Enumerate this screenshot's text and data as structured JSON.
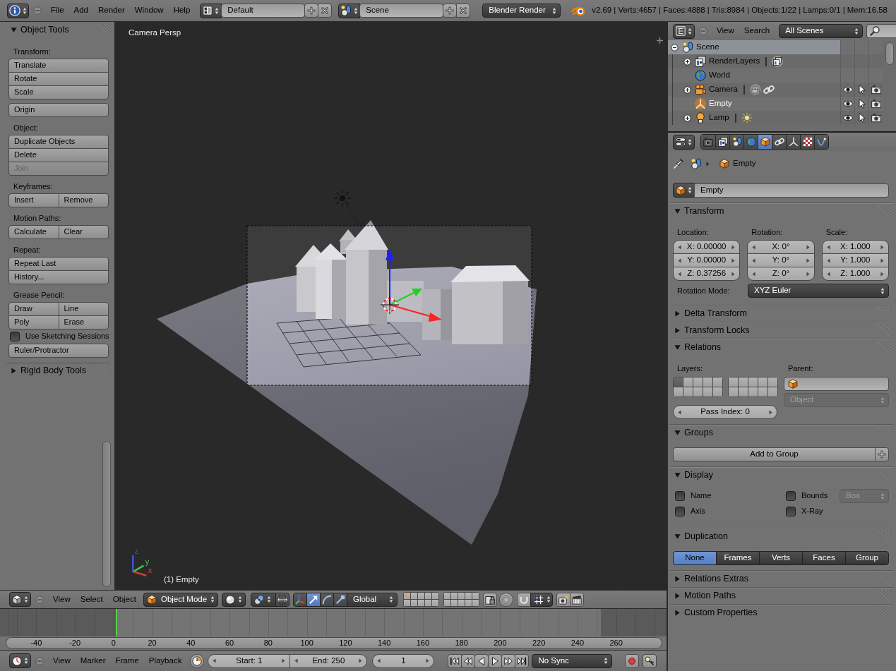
{
  "top_bar": {
    "menus": [
      "File",
      "Add",
      "Render",
      "Window",
      "Help"
    ],
    "layout": "Default",
    "scene": "Scene",
    "render_engine": "Blender Render",
    "stats": "v2.69 | Verts:4657 | Faces:4888 | Tris:8984 | Objects:1/22 | Lamps:0/1 | Mem:16.58"
  },
  "tool_shelf": {
    "panels": [
      {
        "title": "Object Tools",
        "expanded": true,
        "sections": [
          {
            "label": "Transform:",
            "rows": [
              [
                {
                  "kind": "button",
                  "label": "Translate",
                  "disabled": false
                }
              ],
              [
                {
                  "kind": "button",
                  "label": "Rotate",
                  "disabled": false
                }
              ],
              [
                {
                  "kind": "button",
                  "label": "Scale",
                  "disabled": false
                }
              ]
            ]
          },
          {
            "rows": [
              [
                {
                  "kind": "button",
                  "label": "Origin",
                  "disabled": false
                }
              ]
            ]
          },
          {
            "label": "Object:",
            "rows": [
              [
                {
                  "kind": "button",
                  "label": "Duplicate Objects",
                  "disabled": false
                }
              ],
              [
                {
                  "kind": "button",
                  "label": "Delete",
                  "disabled": false
                }
              ],
              [
                {
                  "kind": "button",
                  "label": "Join",
                  "disabled": true
                }
              ]
            ]
          },
          {
            "label": "Keyframes:",
            "rows": [
              [
                {
                  "kind": "button",
                  "label": "Insert",
                  "disabled": false
                },
                {
                  "kind": "button",
                  "label": "Remove",
                  "disabled": false
                }
              ]
            ]
          },
          {
            "label": "Motion Paths:",
            "rows": [
              [
                {
                  "kind": "button",
                  "label": "Calculate",
                  "disabled": false
                },
                {
                  "kind": "button",
                  "label": "Clear",
                  "disabled": false
                }
              ]
            ]
          },
          {
            "label": "Repeat:",
            "rows": [
              [
                {
                  "kind": "button",
                  "label": "Repeat Last",
                  "disabled": false
                }
              ],
              [
                {
                  "kind": "button",
                  "label": "History...",
                  "disabled": false
                }
              ]
            ]
          },
          {
            "label": "Grease Pencil:",
            "rows": [
              [
                {
                  "kind": "button",
                  "label": "Draw",
                  "disabled": false
                },
                {
                  "kind": "button",
                  "label": "Line",
                  "disabled": false
                }
              ],
              [
                {
                  "kind": "button",
                  "label": "Poly",
                  "disabled": false
                },
                {
                  "kind": "button",
                  "label": "Erase",
                  "disabled": false
                }
              ],
              [
                {
                  "kind": "checkbox",
                  "label": "Use Sketching Sessions",
                  "checked": false
                }
              ],
              [
                {
                  "kind": "button",
                  "label": "Ruler/Protractor",
                  "disabled": false
                }
              ]
            ]
          }
        ]
      },
      {
        "title": "Rigid Body Tools",
        "expanded": false
      }
    ]
  },
  "viewport": {
    "view_name": "Camera Persp",
    "axes": [
      {
        "label": "z",
        "color": "#3c50dc"
      },
      {
        "label": "y",
        "color": "#46c846"
      },
      {
        "label": "x",
        "color": "#d23c3c"
      }
    ],
    "object_info": "(1) Empty"
  },
  "view_header": {
    "menus": [
      "View",
      "Select",
      "Object"
    ],
    "mode": "Object Mode",
    "manipulators": [
      {
        "kind": "toggle",
        "selected": false
      },
      {
        "kind": "translate",
        "selected": true
      },
      {
        "kind": "rotate",
        "selected": false
      },
      {
        "kind": "scale",
        "selected": false
      }
    ],
    "orientation": "Global",
    "layers": [
      {
        "cells": [
          {
            "used": true
          },
          {
            "used": false
          },
          {
            "used": false
          },
          {
            "used": false
          },
          {
            "used": false
          },
          {
            "used": false
          },
          {
            "used": false
          },
          {
            "used": false
          },
          {
            "used": false
          },
          {
            "used": false
          }
        ]
      },
      {
        "cells": [
          {
            "used": false
          },
          {
            "used": false
          },
          {
            "used": false
          },
          {
            "used": false
          },
          {
            "used": false
          },
          {
            "used": false
          },
          {
            "used": false
          },
          {
            "used": false
          },
          {
            "used": false
          },
          {
            "used": false
          }
        ]
      }
    ]
  },
  "timeline": {
    "frame_numbers": [
      "-40",
      "-20",
      "0",
      "20",
      "40",
      "60",
      "80",
      "100",
      "120",
      "140",
      "160",
      "180",
      "200",
      "220",
      "240",
      "260"
    ],
    "playhead": {
      "level": 0.174
    }
  },
  "timeline_header": {
    "menus": [
      "View",
      "Marker",
      "Frame",
      "Playback"
    ],
    "start": "Start: 1",
    "end": "End: 250",
    "current_frame": "1",
    "sync": "No Sync"
  },
  "outliner": {
    "menus": [
      "View",
      "Search"
    ],
    "filter": "All Scenes",
    "tree": [
      {
        "label": "Scene",
        "kind": "scene",
        "expanded": true,
        "selected": true,
        "active": false,
        "children": [
          {
            "label": "RenderLayers",
            "kind": "render_layers",
            "expanded": false,
            "selected": false,
            "active": false
          },
          {
            "label": "World",
            "kind": "world",
            "selected": false,
            "active": false
          },
          {
            "label": "Camera",
            "kind": "camera",
            "expanded": false,
            "selected": false,
            "active": false
          },
          {
            "label": "Empty",
            "kind": "empty",
            "selected": false,
            "active": true
          },
          {
            "label": "Lamp",
            "kind": "lamp",
            "expanded": false,
            "selected": false,
            "active": false
          }
        ]
      }
    ]
  },
  "properties": {
    "tabs": [
      {
        "kind": "render",
        "selected": false
      },
      {
        "kind": "render_layers",
        "selected": false
      },
      {
        "kind": "scene",
        "selected": false
      },
      {
        "kind": "world",
        "selected": false
      },
      {
        "kind": "object",
        "selected": true
      },
      {
        "kind": "constraints",
        "selected": false
      },
      {
        "kind": "data",
        "selected": false
      },
      {
        "kind": "texture",
        "selected": false
      },
      {
        "kind": "physics",
        "selected": false
      }
    ],
    "breadcrumb": "Empty",
    "object_name": "Empty",
    "panels": [
      {
        "kind": "transform",
        "title": "Transform",
        "expanded": true,
        "columns": [
          {
            "label": "Location:",
            "fields": [
              "X: 0.00000",
              "Y: 0.00000",
              "Z: 0.37256"
            ]
          },
          {
            "label": "Rotation:",
            "fields": [
              "X: 0°",
              "Y: 0°",
              "Z: 0°"
            ]
          },
          {
            "label": "Scale:",
            "fields": [
              "X: 1.000",
              "Y: 1.000",
              "Z: 1.000"
            ]
          }
        ],
        "rotation_mode": {
          "label": "Rotation Mode:",
          "value": "XYZ Euler"
        }
      },
      {
        "title": "Delta Transform",
        "expanded": false
      },
      {
        "title": "Transform Locks",
        "expanded": false
      },
      {
        "kind": "relations",
        "title": "Relations",
        "expanded": true,
        "layers_label": "Layers:",
        "layers": [
          [
            true,
            false,
            false,
            false,
            false,
            false,
            false,
            false,
            false,
            false
          ],
          [
            false,
            false,
            false,
            false,
            false,
            false,
            false,
            false,
            false,
            false
          ]
        ],
        "parent_label": "Parent:",
        "parent_type": {
          "value": "Object",
          "disabled": true
        },
        "pass_index": "Pass Index: 0"
      },
      {
        "kind": "groups",
        "title": "Groups",
        "expanded": true,
        "button": "Add to Group"
      },
      {
        "kind": "display",
        "title": "Display",
        "expanded": true,
        "checkboxes": [
          {
            "label": "Name",
            "checked": false
          },
          {
            "label": "Bounds",
            "checked": false
          },
          {
            "label": "Axis",
            "checked": false
          },
          {
            "label": "X-Ray",
            "checked": false
          }
        ],
        "bounds_type": {
          "value": "Box",
          "disabled": true
        }
      },
      {
        "kind": "duplication",
        "title": "Duplication",
        "expanded": true,
        "options": [
          {
            "label": "None",
            "selected": true
          },
          {
            "label": "Frames",
            "selected": false
          },
          {
            "label": "Verts",
            "selected": false
          },
          {
            "label": "Faces",
            "selected": false
          },
          {
            "label": "Group",
            "selected": false
          }
        ]
      },
      {
        "title": "Relations Extras",
        "expanded": false
      },
      {
        "title": "Motion Paths",
        "expanded": false
      },
      {
        "title": "Custom Properties",
        "expanded": false
      }
    ]
  }
}
